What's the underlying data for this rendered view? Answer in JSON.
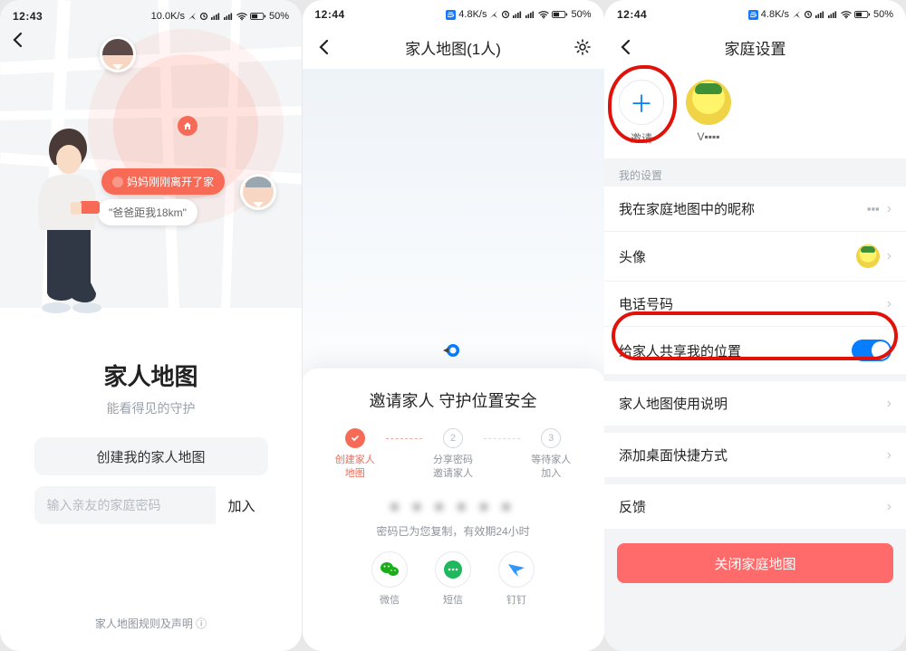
{
  "status": {
    "time1": "12:43",
    "time2": "12:44",
    "time3": "12:44",
    "net1": "10.0K/s",
    "net2": "4.8K/s",
    "net3": "4.8K/s",
    "battery": "50%"
  },
  "screen1": {
    "back_icon": "‹",
    "bubble_mom": "妈妈刚刚离开了家",
    "bubble_dad": "\"爸爸距我18km\"",
    "title": "家人地图",
    "subtitle": "能看得见的守护",
    "create_btn": "创建我的家人地图",
    "input_placeholder": "输入亲友的家庭密码",
    "join_btn": "加入",
    "rules": "家人地图规则及声明 ⓘ"
  },
  "screen2": {
    "nav_title": "家人地图(1人)",
    "panel_title": "邀请家人 守护位置安全",
    "steps": [
      {
        "label": "创建家人\n地图",
        "done": true
      },
      {
        "label": "分享密码\n邀请家人",
        "done": false,
        "num": "2"
      },
      {
        "label": "等待家人\n加入",
        "done": false,
        "num": "3"
      }
    ],
    "password_mask": "▪ ▪ ▪ ▪ ▪ ▪",
    "password_hint": "密码已为您复制，有效期24小时",
    "share": {
      "wechat": "微信",
      "sms": "短信",
      "dingtalk": "钉钉"
    }
  },
  "screen3": {
    "nav_title": "家庭设置",
    "invite": "邀请",
    "member_name": "V▪▪▪▪",
    "section_my": "我的设置",
    "cells": {
      "nickname_label": "我在家庭地图中的昵称",
      "nickname_value": "▪▪▪",
      "avatar_label": "头像",
      "phone_label": "电话号码",
      "share_loc_label": "给家人共享我的位置",
      "help_label": "家人地图使用说明",
      "shortcut_label": "添加桌面快捷方式",
      "feedback_label": "反馈"
    },
    "close_btn": "关闭家庭地图",
    "share_toggle_on": true
  }
}
